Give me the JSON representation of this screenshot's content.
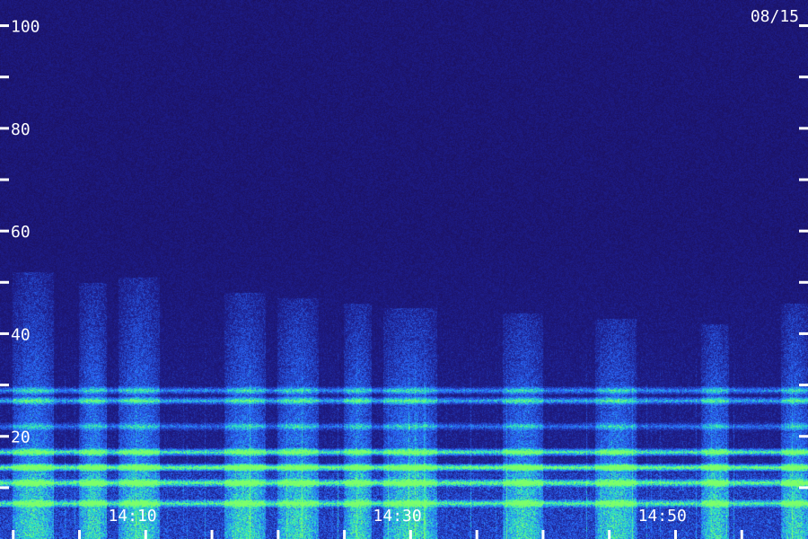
{
  "chart_data": {
    "type": "heatmap",
    "date_label": "08/15",
    "y_axis": {
      "ticks": [
        {
          "value": 100,
          "label": "100"
        },
        {
          "value": 90,
          "label": ""
        },
        {
          "value": 80,
          "label": "80"
        },
        {
          "value": 70,
          "label": ""
        },
        {
          "value": 60,
          "label": "60"
        },
        {
          "value": 50,
          "label": ""
        },
        {
          "value": 40,
          "label": "40"
        },
        {
          "value": 30,
          "label": ""
        },
        {
          "value": 20,
          "label": "20"
        },
        {
          "value": 10,
          "label": ""
        }
      ],
      "range": [
        0,
        105
      ]
    },
    "x_axis": {
      "labels": [
        "14:10",
        "14:30",
        "14:50"
      ],
      "range_minutes": [
        "14:00",
        "15:01"
      ]
    },
    "colors": {
      "background": "#1a0a4a",
      "low": "#1e1e8c",
      "mid": "#2a6cff",
      "high": "#28e0c8",
      "peak": "#7dff6a",
      "tick": "#ffffff"
    },
    "bands": [
      {
        "freq": 29,
        "intensity": 0.45
      },
      {
        "freq": 27,
        "intensity": 0.55
      },
      {
        "freq": 22,
        "intensity": 0.35
      },
      {
        "freq": 17,
        "intensity": 0.75
      },
      {
        "freq": 14,
        "intensity": 0.9
      },
      {
        "freq": 11,
        "intensity": 0.7
      },
      {
        "freq": 7,
        "intensity": 0.6
      }
    ],
    "activity_periods": [
      {
        "start": "14:01",
        "end": "14:04",
        "max_freq": 52
      },
      {
        "start": "14:06",
        "end": "14:08",
        "max_freq": 50
      },
      {
        "start": "14:09",
        "end": "14:12",
        "max_freq": 51
      },
      {
        "start": "14:17",
        "end": "14:20",
        "max_freq": 48
      },
      {
        "start": "14:21",
        "end": "14:24",
        "max_freq": 47
      },
      {
        "start": "14:26",
        "end": "14:28",
        "max_freq": 46
      },
      {
        "start": "14:29",
        "end": "14:33",
        "max_freq": 45
      },
      {
        "start": "14:38",
        "end": "14:41",
        "max_freq": 44
      },
      {
        "start": "14:45",
        "end": "14:48",
        "max_freq": 43
      },
      {
        "start": "14:53",
        "end": "14:55",
        "max_freq": 42
      },
      {
        "start": "14:59",
        "end": "15:01",
        "max_freq": 46
      }
    ]
  }
}
